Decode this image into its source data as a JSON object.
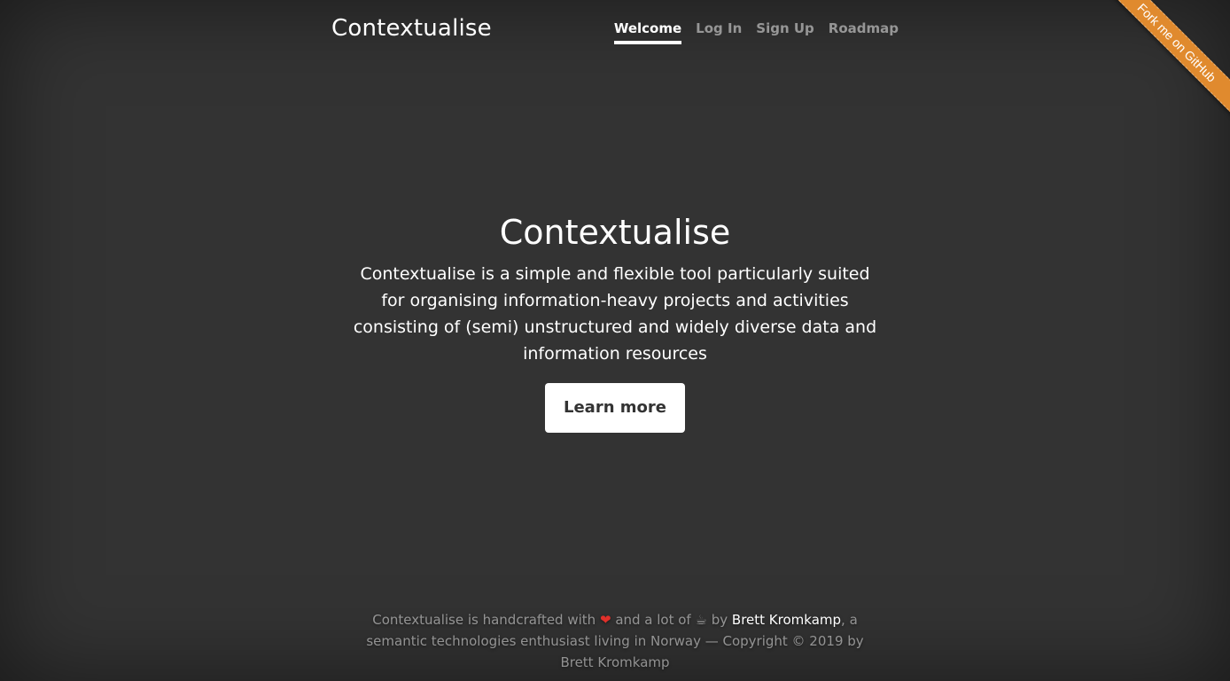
{
  "header": {
    "brand": "Contextualise",
    "nav": [
      {
        "label": "Welcome",
        "active": true
      },
      {
        "label": "Log In",
        "active": false
      },
      {
        "label": "Sign Up",
        "active": false
      },
      {
        "label": "Roadmap",
        "active": false
      }
    ]
  },
  "cover": {
    "heading": "Contextualise",
    "lead": "Contextualise is a simple and flexible tool particularly suited for organising information-heavy projects and activities consisting of (semi) unstructured and widely diverse data and information resources",
    "button_label": "Learn more"
  },
  "footer": {
    "text_before_heart": "Contextualise is handcrafted with",
    "heart": "❤",
    "text_after_heart": "and a lot of",
    "cup": "☕",
    "text_by": "by",
    "author_link": "Brett Kromkamp",
    "text_after_author": ", a semantic technologies enthusiast living in Norway — Copyright © 2019 by Brett Kromkamp"
  },
  "ribbon": {
    "label": "Fork me on GitHub",
    "color": "#e08a2e"
  },
  "colors": {
    "background": "#333333",
    "text": "#ffffff"
  }
}
